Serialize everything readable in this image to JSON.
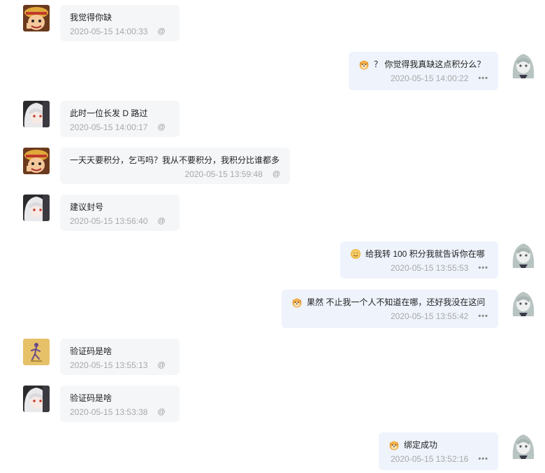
{
  "messages": [
    {
      "side": "left",
      "avatar": "pirate-boy-avatar",
      "text": "我觉得你缺",
      "time": "2020-05-15 14:00:33",
      "action": "@"
    },
    {
      "side": "right",
      "avatar": "silver-hair-girl-avatar",
      "emoji": "dog-emoji",
      "text": "？ 你觉得我真缺这点积分么？",
      "time": "2020-05-15 14:00:22",
      "action": "•••"
    },
    {
      "side": "left",
      "avatar": "white-hair-anime-avatar",
      "text": "此时一位长发 D 路过",
      "time": "2020-05-15 14:00:17",
      "action": "@"
    },
    {
      "side": "left",
      "avatar": "pirate-boy-avatar",
      "text": "一天天要积分，乞丐吗？我从不要积分，我积分比谁都多",
      "time": "2020-05-15 13:59:48",
      "action": "@"
    },
    {
      "side": "left",
      "avatar": "white-hair-anime-avatar",
      "text": "建议封号",
      "time": "2020-05-15 13:56:40",
      "action": "@"
    },
    {
      "side": "right",
      "avatar": "silver-hair-girl-avatar",
      "emoji": "smile-face-emoji",
      "text": "给我转 100 积分我就告诉你在哪",
      "time": "2020-05-15 13:55:53",
      "action": "•••"
    },
    {
      "side": "right",
      "avatar": "silver-hair-girl-avatar",
      "emoji": "dog-emoji",
      "text": "果然 不止我一个人不知道在哪，还好我没在这问",
      "time": "2020-05-15 13:55:42",
      "action": "•••"
    },
    {
      "side": "left",
      "avatar": "yellow-figure-avatar",
      "text": "验证码是啥",
      "time": "2020-05-15 13:55:13",
      "action": "@"
    },
    {
      "side": "left",
      "avatar": "white-hair-anime-avatar",
      "text": "验证码是啥",
      "time": "2020-05-15 13:53:38",
      "action": "@"
    },
    {
      "side": "right",
      "avatar": "silver-hair-girl-avatar",
      "emoji": "dog-emoji",
      "text": "绑定成功",
      "time": "2020-05-15 13:52:16",
      "action": "•••"
    }
  ],
  "colors": {
    "left_bubble": "#f5f6f8",
    "right_bubble": "#eef3fc",
    "text": "#222222",
    "meta": "#a8a8a8"
  }
}
